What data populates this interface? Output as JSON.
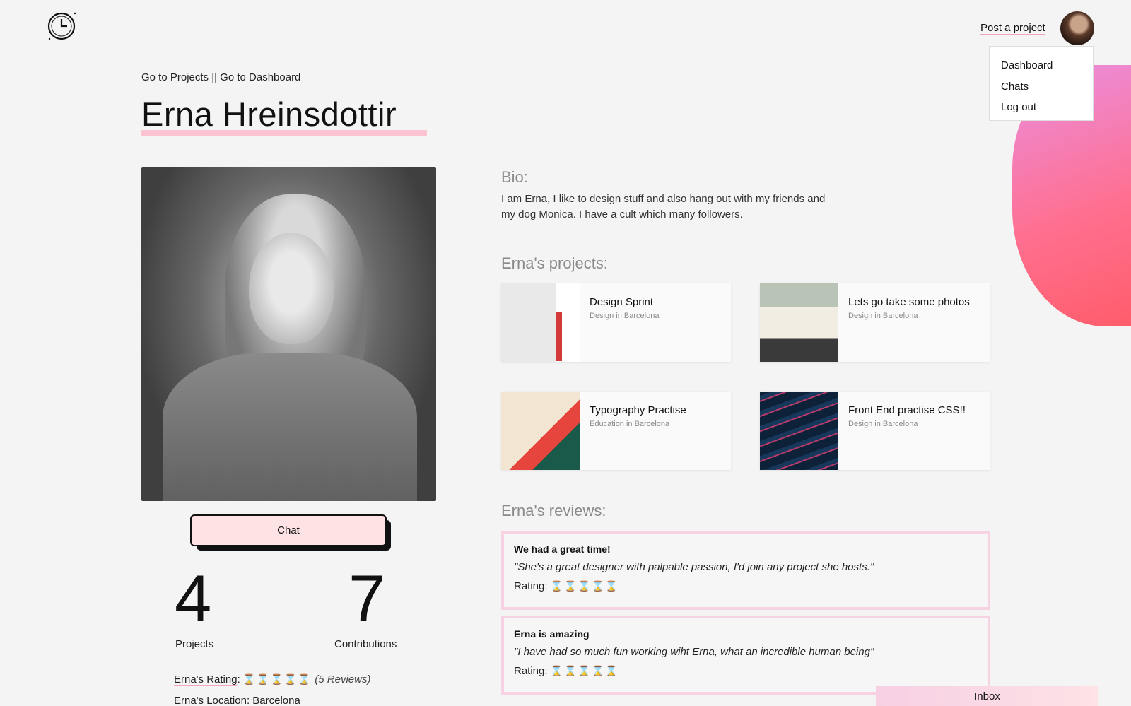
{
  "header": {
    "post_project": "Post a project"
  },
  "user_menu": {
    "items": [
      "Dashboard",
      "Chats",
      "Log out"
    ]
  },
  "profile": {
    "breadcrumb": "Go to Projects || Go to Dashboard",
    "name": "Erna Hreinsdottir",
    "chat_button": "Chat",
    "stats": {
      "projects_count": "4",
      "projects_label": "Projects",
      "contributions_count": "7",
      "contributions_label": "Contributions"
    },
    "rating_label": "Erna's Rating",
    "rating_hourglasses": "⌛⌛⌛⌛⌛",
    "rating_reviews": "(5 Reviews)",
    "location_label": "Erna's Location",
    "location_value": "Barcelona"
  },
  "bio": {
    "title": "Bio:",
    "text": "I am Erna, I like to design stuff and also hang out with my friends and my dog Monica. I have a cult which many followers."
  },
  "projects": {
    "title": "Erna's projects:",
    "items": [
      {
        "title": "Design Sprint",
        "subtitle": "Design in Barcelona"
      },
      {
        "title": "Lets go take some photos",
        "subtitle": "Design in Barcelona"
      },
      {
        "title": "Typography Practise",
        "subtitle": "Education in Barcelona"
      },
      {
        "title": "Front End practise CSS!!",
        "subtitle": "Design in Barcelona"
      }
    ]
  },
  "reviews": {
    "title": "Erna's reviews:",
    "rating_label": "Rating:",
    "items": [
      {
        "title": "We had a great time!",
        "quote": "\"She's a great designer with palpable passion, I'd join any project she hosts.\"",
        "stars": "⌛⌛⌛⌛⌛"
      },
      {
        "title": "Erna is amazing",
        "quote": "\"I have had so much fun working wiht Erna, what an incredible human being\"",
        "stars": "⌛⌛⌛⌛⌛"
      }
    ]
  },
  "inbox": {
    "label": "Inbox"
  },
  "colors": {
    "accent_pink": "#fcc4d2",
    "chat_button_bg": "#fde3e3",
    "review_border": "#f7d2e2",
    "blob_start": "#ea8fe0",
    "blob_end": "#ff5a66"
  },
  "icons": {
    "logo": "clock-logo-icon",
    "rating": "hourglass-icon"
  }
}
